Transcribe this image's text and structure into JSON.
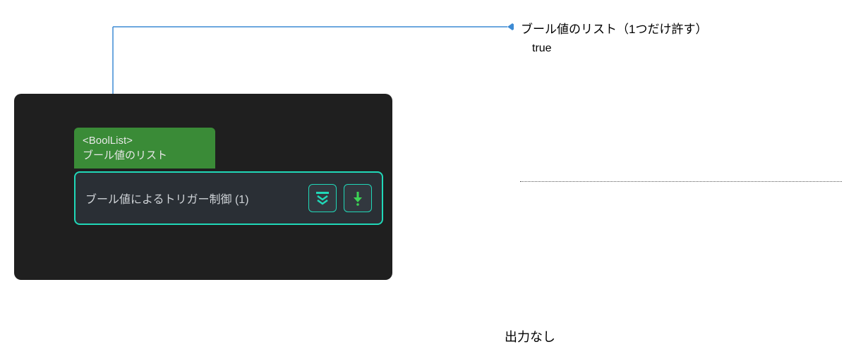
{
  "annotation": {
    "title": "ブール値のリスト（1つだけ許す）",
    "value": "true"
  },
  "panel": {
    "typeTagLine1": "<BoolList>",
    "typeTagLine2": "ブール値のリスト",
    "nodeLabel": "ブール値によるトリガー制御 (1)"
  },
  "output": "出力なし"
}
